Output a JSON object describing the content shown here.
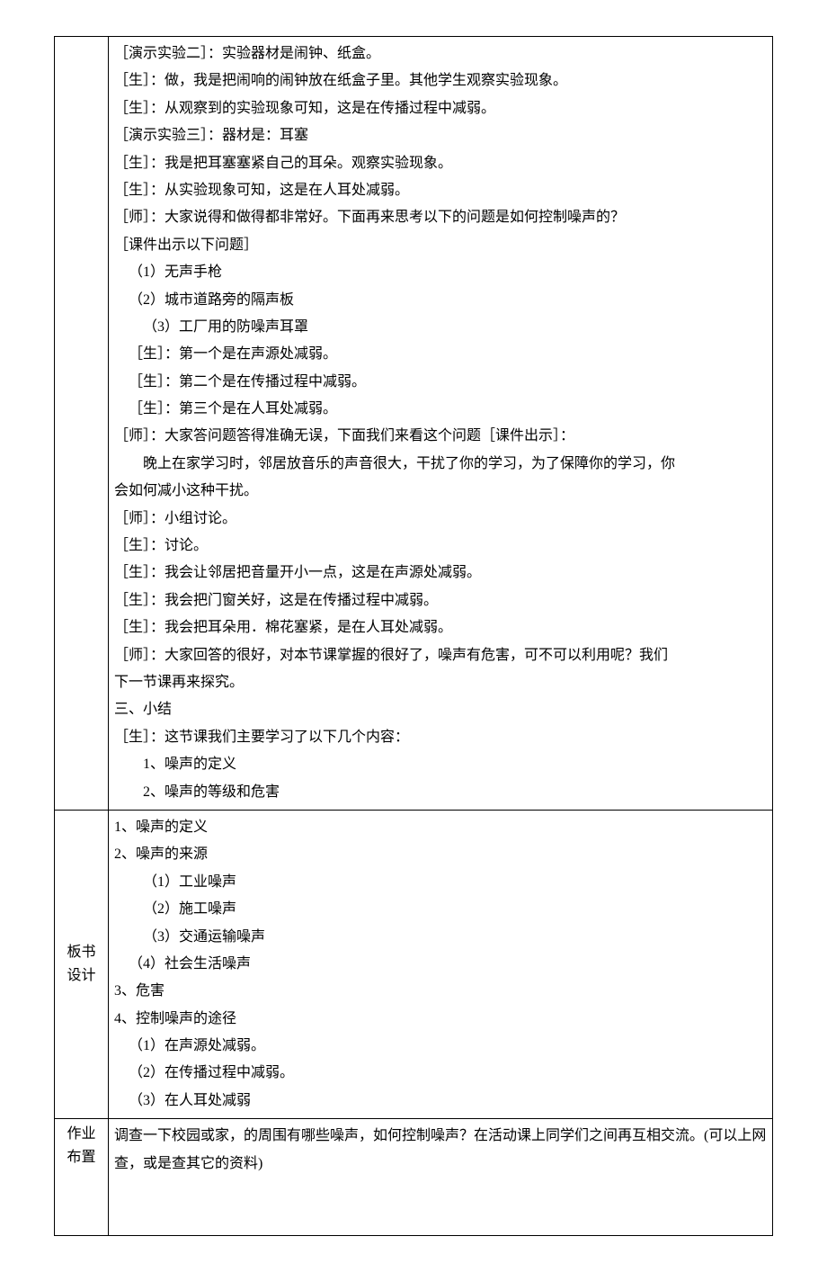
{
  "section1": {
    "lines": [
      {
        "cls": "",
        "text": "［演示实验二］：实验器材是闹钟、纸盒。"
      },
      {
        "cls": "",
        "text": "［生］：做，我是把闹响的闹钟放在纸盒子里。其他学生观察实验现象。"
      },
      {
        "cls": "",
        "text": "［生］：从观察到的实验现象可知，这是在传播过程中减弱。"
      },
      {
        "cls": "",
        "text": "［演示实验三］：器材是：耳塞"
      },
      {
        "cls": "",
        "text": "［生］：我是把耳塞塞紧自己的耳朵。观察实验现象。"
      },
      {
        "cls": "",
        "text": "［生］：从实验现象可知，这是在人耳处减弱。"
      },
      {
        "cls": "",
        "text": "［师］：大家说得和做得都非常好。下面再来思考以下的问题是如何控制噪声的？"
      },
      {
        "cls": "",
        "text": "［课件出示以下问题］"
      },
      {
        "cls": "indent1",
        "text": "（1）无声手枪"
      },
      {
        "cls": "indent1",
        "text": "（2）城市道路旁的隔声板"
      },
      {
        "cls": "indent2",
        "text": "（3）工厂用的防噪声耳罩"
      },
      {
        "cls": "indent1",
        "text": "［生］：第一个是在声源处减弱。"
      },
      {
        "cls": "indent1",
        "text": "［生］：第二个是在传播过程中减弱。"
      },
      {
        "cls": "indent1",
        "text": "［生］：第三个是在人耳处减弱。"
      },
      {
        "cls": "",
        "text": "［师］：大家答问题答得准确无误，下面我们来看这个问题［课件出示］："
      },
      {
        "cls": "indent2",
        "text": "晚上在家学习时，邻居放音乐的声音很大，干扰了你的学习，为了保障你的学习，你"
      },
      {
        "cls": "",
        "text": "会如何减小这种干扰。"
      },
      {
        "cls": "",
        "text": "［师］：小组讨论。"
      },
      {
        "cls": "",
        "text": "［生］：讨论。"
      },
      {
        "cls": "",
        "text": "［生］：我会让邻居把音量开小一点，这是在声源处减弱。"
      },
      {
        "cls": "",
        "text": "［生］：我会把门窗关好，这是在传播过程中减弱。"
      },
      {
        "cls": "",
        "text": "［生］：我会把耳朵用．棉花塞紧，是在人耳处减弱。"
      },
      {
        "cls": "",
        "text": "［师］：大家回答的很好，对本节课掌握的很好了，噪声有危害，可不可以利用呢？我们"
      },
      {
        "cls": "",
        "text": "下一节课再来探究。"
      },
      {
        "cls": "",
        "text": "三、小结"
      },
      {
        "cls": "",
        "text": "［生］：这节课我们主要学习了以下几个内容："
      },
      {
        "cls": "indent2",
        "text": "1、噪声的定义"
      },
      {
        "cls": "indent2",
        "text": "2、噪声的等级和危害"
      }
    ]
  },
  "section2": {
    "label": "板书\n设计",
    "lines": [
      {
        "cls": "",
        "text": "1、噪声的定义"
      },
      {
        "cls": "",
        "text": "2、噪声的来源"
      },
      {
        "cls": "indent2",
        "text": "（1）工业噪声"
      },
      {
        "cls": "indent2",
        "text": "（2）施工噪声"
      },
      {
        "cls": "indent2",
        "text": "（3）交通运输噪声"
      },
      {
        "cls": "indent1",
        "text": "（4）社会生活噪声"
      },
      {
        "cls": "",
        "text": "3、危害"
      },
      {
        "cls": "",
        "text": "4、控制噪声的途径"
      },
      {
        "cls": "indent1",
        "text": "（1）在声源处减弱。"
      },
      {
        "cls": "indent1",
        "text": "（2）在传播过程中减弱。"
      },
      {
        "cls": "indent1",
        "text": "（3）在人耳处减弱"
      }
    ]
  },
  "section3": {
    "label": "作业\n布置",
    "text": "调查一下校园或家，的周围有哪些噪声，如何控制噪声？在活动课上同学们之间再互相交流。(可以上网查，或是查其它的资料)"
  }
}
